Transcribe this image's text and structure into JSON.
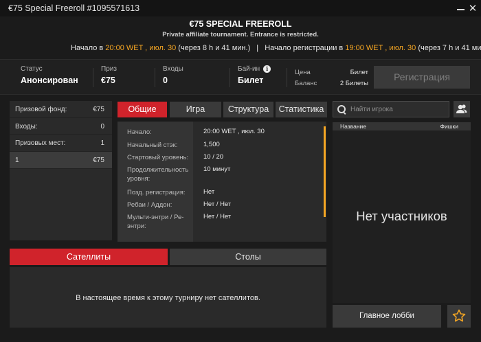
{
  "window": {
    "title": "€75 Special Freeroll #1095571613",
    "close_glyph": "✕"
  },
  "header": {
    "name": "€75 SPECIAL FREEROLL",
    "subtitle": "Private affiliate tournament. Entrance is restricted.",
    "start_label": "Начало в",
    "start_time": "20:00 WET , июл. 30",
    "start_remaining": "(через 8 h и 41 мин.)",
    "separator": "|",
    "reg_label": "Начало регистрации в",
    "reg_time": "19:00 WET , июл. 30",
    "reg_remaining": "(через 7 h и 41 мин.)"
  },
  "info": {
    "status_label": "Статус",
    "status_value": "Анонсирован",
    "prize_label": "Приз",
    "prize_value": "€75",
    "entries_label": "Входы",
    "entries_value": "0",
    "buyin_label": "Бай-ин",
    "buyin_value": "Билет",
    "buyin_info_glyph": "i",
    "price_label": "Цена",
    "price_value": "Билет",
    "balance_label": "Баланс",
    "balance_value": "2 Билеты",
    "register_button": "Регистрация"
  },
  "prize_panel": {
    "rows": [
      {
        "label": "Призовой фонд:",
        "value": "€75"
      },
      {
        "label": "Входы:",
        "value": "0"
      },
      {
        "label": "Призовых мест:",
        "value": "1"
      }
    ],
    "payouts": [
      {
        "place": "1",
        "amount": "€75"
      }
    ]
  },
  "tabs": {
    "general": "Общие",
    "game": "Игра",
    "structure": "Структура",
    "stats": "Статистика",
    "active": "general"
  },
  "details": [
    {
      "key": "Начало:",
      "value": "20:00 WET , июл. 30"
    },
    {
      "key": "Начальный стэк:",
      "value": "1,500"
    },
    {
      "key": "Стартовый уровень:",
      "value": "10 / 20"
    },
    {
      "key": "Продолжительность уровня:",
      "value": "10 минут"
    },
    {
      "key": "Позд. регистрация:",
      "value": "Нет"
    },
    {
      "key": "Ребаи / Аддон:",
      "value": "Нет / Нет"
    },
    {
      "key": "Мульти-энтри / Ре-энтри:",
      "value": "Нет / Нет"
    }
  ],
  "bottom_tabs": {
    "satellites": "Сателлиты",
    "tables": "Столы",
    "active": "satellites"
  },
  "satellites_message": "В настоящее время к этому турниру нет сателлитов.",
  "players": {
    "search_placeholder": "Найти игрока",
    "col_name": "Название",
    "col_chips": "Фишки",
    "empty": "Нет участников"
  },
  "footer": {
    "main_lobby": "Главное лобби"
  },
  "icons": {
    "search": "search-icon",
    "user": "user-icon",
    "favorite": "star-icon"
  },
  "colors": {
    "accent": "#d0232b",
    "highlight": "#f5a623",
    "background": "#1b1b1b"
  }
}
